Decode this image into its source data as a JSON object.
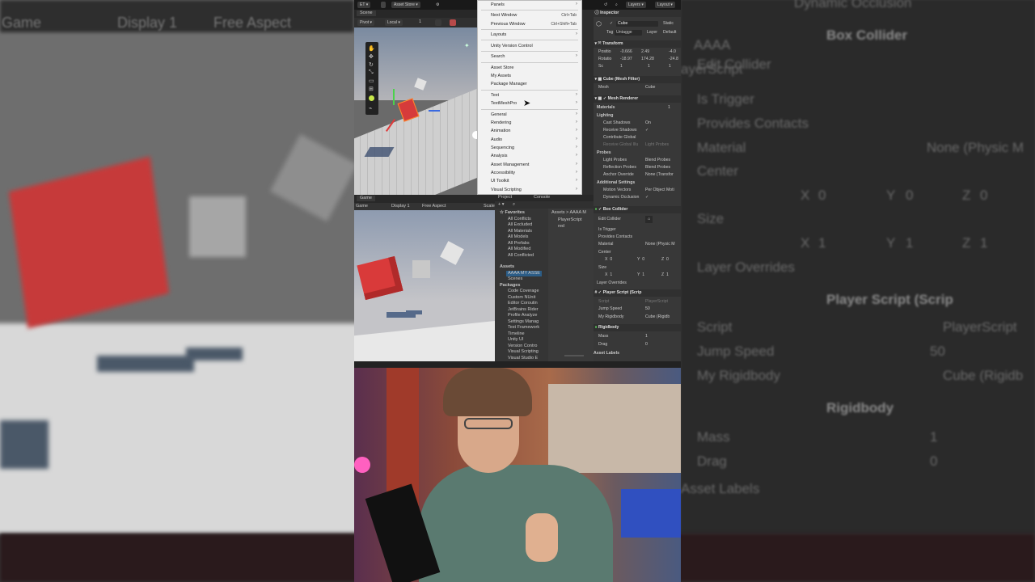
{
  "background_left": {
    "tabs": [
      "Game",
      "Display 1",
      "Free Aspect"
    ]
  },
  "background_right": {
    "items": [
      "Dynamic Occlusion",
      "Box Collider",
      "Edit Collider",
      "Is Trigger",
      "Provides Contacts",
      "Material",
      "None (Physic M",
      "Center",
      "X",
      "0",
      "Y",
      "0",
      "Z",
      "0",
      "Size",
      "X",
      "1",
      "Y",
      "1",
      "Z",
      "1",
      "Layer Overrides",
      "Player Script (Scrip",
      "Script",
      "PlayerScript",
      "Jump Speed",
      "50",
      "My Rigidbody",
      "Cube (Rigidb",
      "Rigidbody",
      "Mass",
      "1",
      "Drag",
      "0",
      "Asset Labels",
      "AAAA",
      "ayerScript"
    ]
  },
  "topbar": {
    "account": "ET",
    "asset_store": "Asset Store",
    "layers": "Layers",
    "layout": "Layout"
  },
  "scene": {
    "tab": "Scene",
    "pivot": "Pivot",
    "local": "Local",
    "num": "1"
  },
  "menu": {
    "items": [
      {
        "label": "Panels",
        "arrow": true
      },
      {
        "label": "Next Window",
        "shortcut": "Ctrl+Tab"
      },
      {
        "label": "Previous Window",
        "shortcut": "Ctrl+Shift+Tab"
      },
      {
        "label": "Layouts",
        "arrow": true
      },
      {
        "label": "Unity Version Control"
      },
      {
        "label": "Search",
        "arrow": true
      },
      {
        "label": "Asset Store"
      },
      {
        "label": "My Assets"
      },
      {
        "label": "Package Manager"
      },
      {
        "label": "Text",
        "arrow": true
      },
      {
        "label": "TextMeshPro",
        "arrow": true
      },
      {
        "label": "General",
        "arrow": true
      },
      {
        "label": "Rendering",
        "arrow": true
      },
      {
        "label": "Animation",
        "arrow": true
      },
      {
        "label": "Audio",
        "arrow": true
      },
      {
        "label": "Sequencing",
        "arrow": true
      },
      {
        "label": "Analysis",
        "arrow": true
      },
      {
        "label": "Asset Management",
        "arrow": true
      },
      {
        "label": "Accessibility",
        "arrow": true
      },
      {
        "label": "UI Toolkit",
        "arrow": true
      },
      {
        "label": "Visual Scripting",
        "arrow": true
      }
    ]
  },
  "inspector": {
    "tab": "Inspector",
    "object_name": "Cube",
    "static": "Static",
    "tag_label": "Tag",
    "tag": "Untagge",
    "layer_label": "Layer",
    "layer": "Default",
    "transform": {
      "title": "Transform",
      "position": {
        "label": "Positio",
        "x": "-0.666",
        "y": "2.49",
        "z": "-4.0"
      },
      "rotation": {
        "label": "Rotatio",
        "x": "-18.97",
        "y": "174.28",
        "z": "-24.8"
      },
      "scale": {
        "label": "Sc",
        "x": "1",
        "y": "1",
        "z": "1"
      }
    },
    "mesh_filter": {
      "title": "Cube (Mesh Filter)",
      "mesh_label": "Mesh",
      "mesh": "Cube"
    },
    "mesh_renderer": {
      "title": "Mesh Renderer",
      "materials": "Materials",
      "materials_count": "1",
      "lighting": "Lighting",
      "cast_shadows": "Cast Shadows",
      "cast_shadows_val": "On",
      "receive_shadows": "Receive Shadows",
      "contribute_gi": "Contribute Global",
      "receive_gi": "Receive Global Illu",
      "receive_gi_val": "Light Probes",
      "probes": "Probes",
      "light_probes": "Light Probes",
      "light_probes_val": "Blend Probes",
      "reflection_probes": "Reflection Probes",
      "reflection_probes_val": "Blend Probes",
      "anchor_override": "Anchor Override",
      "anchor_override_val": "None (Transfor",
      "additional": "Additional Settings",
      "motion_vectors": "Motion Vectors",
      "motion_vectors_val": "Per Object Moti",
      "dynamic_occlusion": "Dynamic Occlusion"
    },
    "box_collider": {
      "title": "Box Collider",
      "edit": "Edit Collider",
      "is_trigger": "Is Trigger",
      "provides_contacts": "Provides Contacts",
      "material": "Material",
      "material_val": "None (Physic M",
      "center": "Center",
      "size": "Size",
      "layer_overrides": "Layer Overrides"
    },
    "player_script": {
      "title": "Player Script (Scrip",
      "script": "Script",
      "script_val": "PlayerScript",
      "jump_speed": "Jump Speed",
      "jump_speed_val": "50",
      "my_rigidbody": "My Rigidbody",
      "my_rigidbody_val": "Cube (Rigidb"
    },
    "rigidbody": {
      "title": "Rigidbody",
      "mass": "Mass",
      "mass_val": "1",
      "drag": "Drag",
      "drag_val": "0"
    },
    "asset_labels": "Asset Labels"
  },
  "game": {
    "tab": "Game",
    "display": "Game",
    "display1": "Display 1",
    "aspect": "Free Aspect",
    "scale": "Scale"
  },
  "project": {
    "tabs": [
      "Project",
      "Console"
    ],
    "favorites": "Favorites",
    "fav_items": [
      "All Conflicts",
      "All Excluded",
      "All Materials",
      "All Models",
      "All Prefabs",
      "All Modified",
      "All Conflicted"
    ],
    "assets": "Assets",
    "asset_items": [
      "AAAA MY ASSE",
      "Scenes"
    ],
    "packages": "Packages",
    "package_items": [
      "Code Coverage",
      "Custom NUnit",
      "Editor Coroutin",
      "JetBrains Rider",
      "Profile Analyze",
      "Settings Manag",
      "Test Framework",
      "Timeline",
      "Unity UI",
      "Version Contro",
      "Visual Scripting",
      "Visual Studio E"
    ],
    "breadcrumb": "Assets > AAAA M",
    "files": [
      "PlayerScript",
      "red"
    ]
  }
}
